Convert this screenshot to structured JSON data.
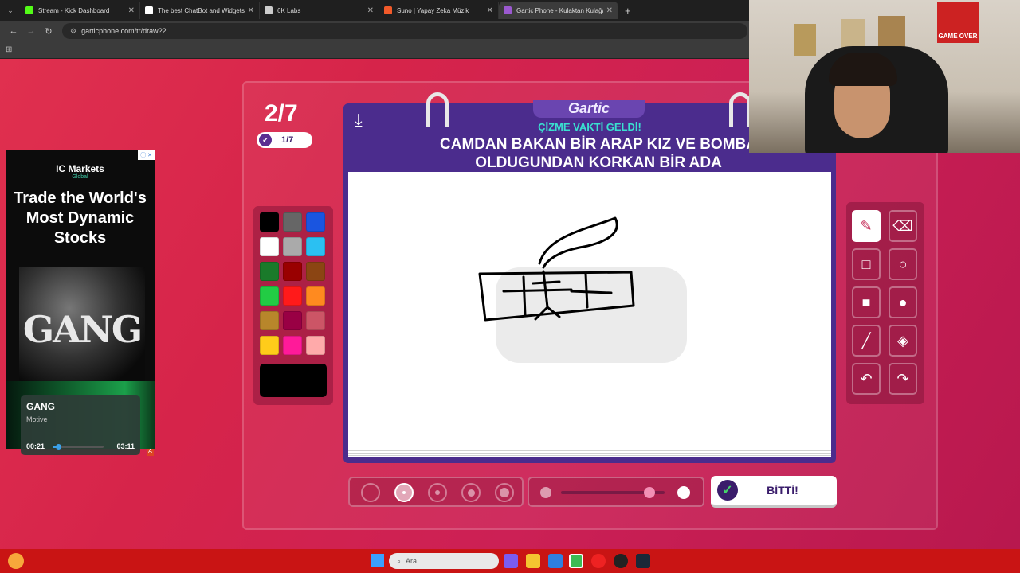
{
  "browser": {
    "tabs": [
      {
        "title": "Stream - Kick Dashboard",
        "favicon_color": "#53fc18",
        "active": false
      },
      {
        "title": "The best ChatBot and Widgets",
        "favicon_color": "#ffffff",
        "active": false
      },
      {
        "title": "6K Labs",
        "favicon_color": "#cccccc",
        "active": false
      },
      {
        "title": "Suno | Yapay Zeka Müzik",
        "favicon_color": "#f25a2a",
        "active": false
      },
      {
        "title": "Gartic Phone - Kulaktan Kulağa",
        "favicon_color": "#9b59d0",
        "active": true
      }
    ],
    "url": "garticphone.com/tr/draw?2"
  },
  "game": {
    "round": "2/7",
    "done_count": "1/7",
    "logo": "Gartic",
    "prompt_header": "ÇİZME VAKTİ GELDİ!",
    "prompt_line1": "CAMDAN BAKAN BİR ARAP KIZ VE BOMBA",
    "prompt_line2": "OLDUGUNDAN KORKAN BİR ADA",
    "palette": [
      "#000000",
      "#666666",
      "#1a55e0",
      "#ffffff",
      "#aaaaaa",
      "#2bc0f2",
      "#1a7a2a",
      "#990000",
      "#8b4513",
      "#22cc44",
      "#ff1a1a",
      "#ff8a1f",
      "#b8862b",
      "#990044",
      "#cc5566",
      "#ffcc1a",
      "#ff1a99",
      "#ffaaaa"
    ],
    "current_color": "#000000",
    "done_button": "BİTTİ!",
    "opacity_level": 0.85,
    "selected_brush_size": 2
  },
  "ad": {
    "brand": "IC Markets",
    "brand_sub": "Global",
    "headline": "Trade the World's Most Dynamic Stocks",
    "art_text": "GANG"
  },
  "player": {
    "song": "GANG",
    "artist": "Motive",
    "elapsed": "00:21",
    "total": "03:11",
    "progress": 0.11
  },
  "taskbar": {
    "search_placeholder": "Ara"
  },
  "webcam": {
    "poster_text": "GAME OVER"
  }
}
